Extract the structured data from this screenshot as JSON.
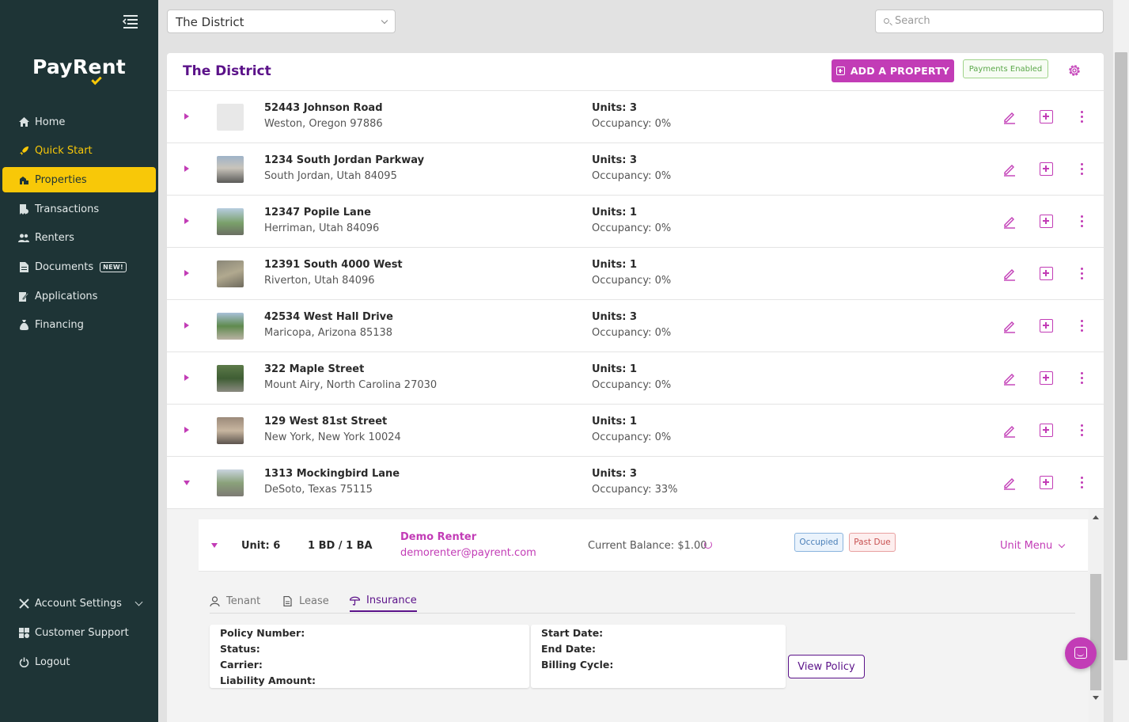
{
  "app": {
    "logo": "PayRent"
  },
  "sidebar": {
    "items": [
      {
        "label": "Home",
        "icon": "home-icon"
      },
      {
        "label": "Quick Start",
        "icon": "rocket-icon"
      },
      {
        "label": "Properties",
        "icon": "building-icon"
      },
      {
        "label": "Transactions",
        "icon": "receipt-icon"
      },
      {
        "label": "Renters",
        "icon": "users-icon"
      },
      {
        "label": "Documents",
        "icon": "document-icon",
        "badge": "NEW!"
      },
      {
        "label": "Applications",
        "icon": "clipboard-icon"
      },
      {
        "label": "Financing",
        "icon": "money-bag-icon"
      }
    ],
    "bottom": [
      {
        "label": "Account Settings",
        "icon": "tools-icon"
      },
      {
        "label": "Customer Support",
        "icon": "support-icon"
      },
      {
        "label": "Logout",
        "icon": "power-icon"
      }
    ]
  },
  "topbar": {
    "selected_property": "The District",
    "search_placeholder": "Search"
  },
  "card": {
    "title": "The District",
    "add_button": "ADD A PROPERTY",
    "payments_badge": "Payments Enabled"
  },
  "properties": [
    {
      "address": "52443 Johnson Road",
      "city": "Weston, Oregon 97886",
      "units": "Units: 3",
      "occupancy": "Occupancy: 0%"
    },
    {
      "address": "1234 South Jordan Parkway",
      "city": "South Jordan, Utah 84095",
      "units": "Units: 3",
      "occupancy": "Occupancy: 0%"
    },
    {
      "address": "12347 Popile Lane",
      "city": "Herriman, Utah 84096",
      "units": "Units: 1",
      "occupancy": "Occupancy: 0%"
    },
    {
      "address": "12391 South 4000 West",
      "city": "Riverton, Utah 84096",
      "units": "Units: 1",
      "occupancy": "Occupancy: 0%"
    },
    {
      "address": "42534 West Hall Drive",
      "city": "Maricopa, Arizona 85138",
      "units": "Units: 3",
      "occupancy": "Occupancy: 0%"
    },
    {
      "address": "322 Maple Street",
      "city": "Mount Airy, North Carolina 27030",
      "units": "Units: 1",
      "occupancy": "Occupancy: 0%"
    },
    {
      "address": "129 West 81st Street",
      "city": "New York, New York 10024",
      "units": "Units: 1",
      "occupancy": "Occupancy: 0%"
    },
    {
      "address": "1313 Mockingbird Lane",
      "city": "DeSoto, Texas 75115",
      "units": "Units: 3",
      "occupancy": "Occupancy: 33%"
    }
  ],
  "unit": {
    "label": "Unit: 6",
    "bed_bath": "1 BD / 1 BA",
    "renter_name": "Demo Renter",
    "renter_email": "demorenter@payrent.com",
    "balance": "Current Balance: $1.00",
    "status_occupied": "Occupied",
    "status_pastdue": "Past Due",
    "menu": "Unit Menu"
  },
  "tabs": [
    {
      "label": "Tenant",
      "icon": "person-icon"
    },
    {
      "label": "Lease",
      "icon": "document-icon"
    },
    {
      "label": "Insurance",
      "icon": "umbrella-icon",
      "active": true
    }
  ],
  "insurance": {
    "policy_number": "Policy Number:",
    "status": "Status:",
    "carrier": "Carrier:",
    "liability": "Liability Amount:",
    "start_date": "Start Date:",
    "end_date": "End Date:",
    "billing_cycle": "Billing Cycle:",
    "view_policy": "View Policy"
  },
  "colors": {
    "sidebar_bg": "#1e3436",
    "accent": "#c23cb6",
    "brand_purple": "#5b1289",
    "highlight": "#f8c808"
  }
}
